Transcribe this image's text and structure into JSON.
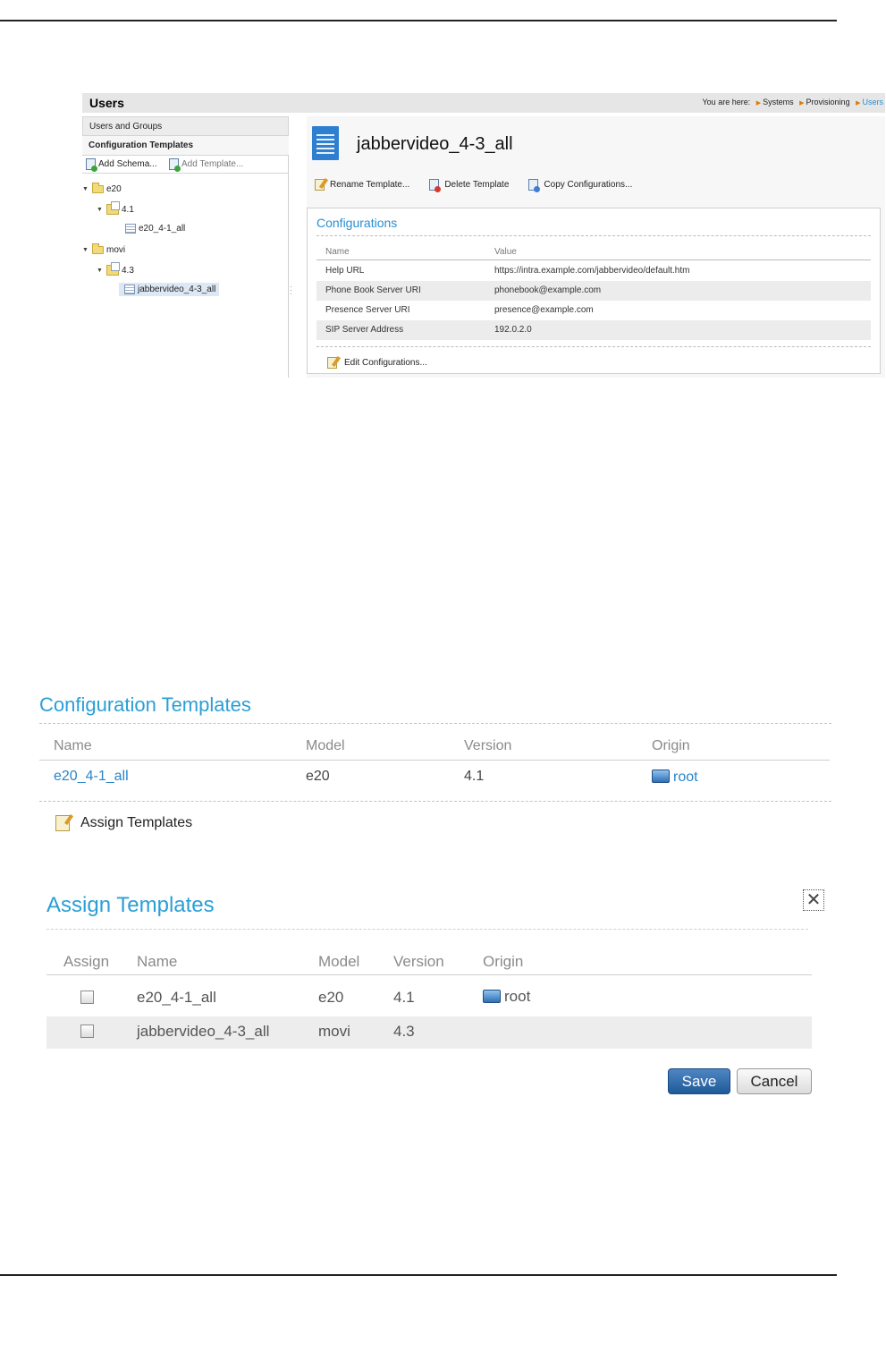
{
  "screen1": {
    "header_title": "Users",
    "breadcrumb": {
      "prefix": "You are here:",
      "items": [
        "Systems",
        "Provisioning",
        "Users"
      ]
    },
    "left_panel": {
      "users_and_groups": "Users and Groups",
      "configuration_templates": "Configuration Templates",
      "add_schema": "Add Schema...",
      "add_template": "Add Template..."
    },
    "tree": {
      "e20": "e20",
      "e20_version": "4.1",
      "e20_template": "e20_4-1_all",
      "movi": "movi",
      "movi_version": "4.3",
      "movi_template": "jabbervideo_4-3_all"
    },
    "template_title": "jabbervideo_4-3_all",
    "actions": {
      "rename": "Rename Template...",
      "delete": "Delete Template",
      "copy": "Copy Configurations..."
    },
    "configurations": {
      "title": "Configurations",
      "col_name": "Name",
      "col_value": "Value",
      "rows": [
        {
          "name": "Help URL",
          "value": "https://intra.example.com/jabbervideo/default.htm"
        },
        {
          "name": "Phone Book Server URI",
          "value": "phonebook@example.com"
        },
        {
          "name": "Presence Server URI",
          "value": "presence@example.com"
        },
        {
          "name": "SIP Server Address",
          "value": "192.0.2.0"
        }
      ],
      "edit": "Edit Configurations..."
    }
  },
  "screen2": {
    "title": "Configuration Templates",
    "columns": [
      "Name",
      "Model",
      "Version",
      "Origin"
    ],
    "row": {
      "name": "e20_4-1_all",
      "model": "e20",
      "version": "4.1",
      "origin": "root"
    },
    "assign": "Assign Templates"
  },
  "screen3": {
    "title": "Assign Templates",
    "columns": [
      "Assign",
      "Name",
      "Model",
      "Version",
      "Origin"
    ],
    "rows": [
      {
        "name": "e20_4-1_all",
        "model": "e20",
        "version": "4.1",
        "origin": "root"
      },
      {
        "name": "jabbervideo_4-3_all",
        "model": "movi",
        "version": "4.3",
        "origin": ""
      }
    ],
    "save": "Save",
    "cancel": "Cancel"
  },
  "colors": {
    "accent": "#2a9fd6",
    "link": "#2a85c8",
    "save_button": "#2f6fb0",
    "breadcrumb_arrow": "#e07a00"
  }
}
